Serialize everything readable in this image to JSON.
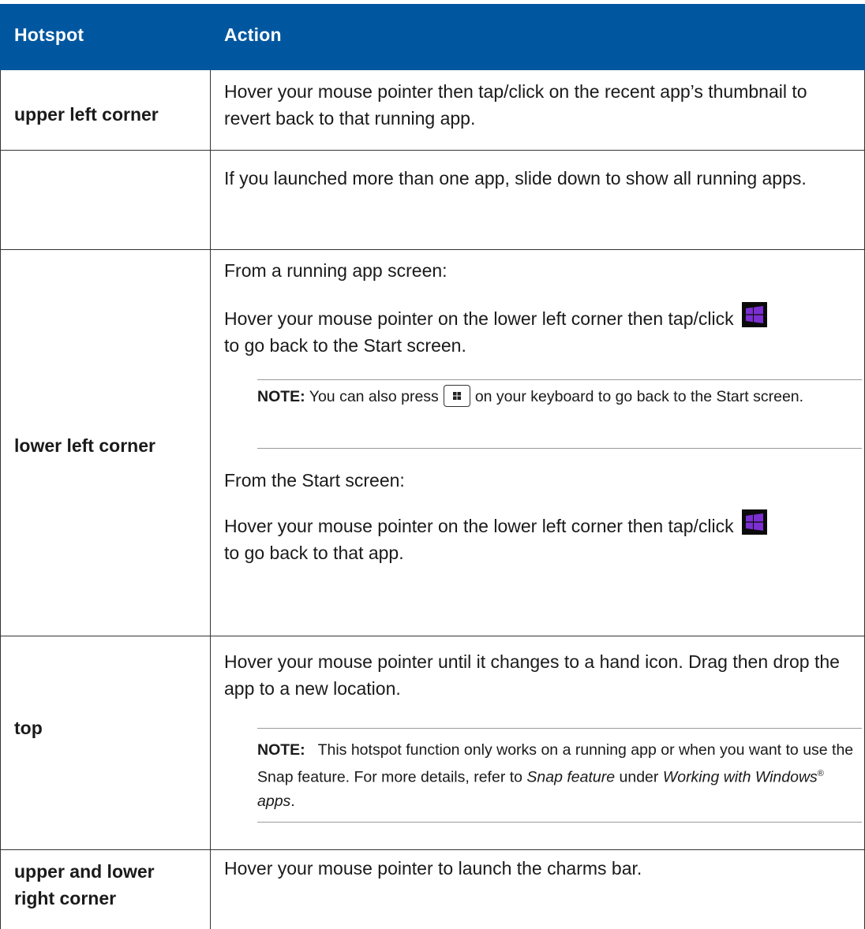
{
  "header": {
    "col1": "Hotspot",
    "col2": "Action"
  },
  "rows": [
    {
      "hotspot": "upper left corner",
      "text": "Hover your mouse pointer then tap/click on the recent app’s thumbnail to revert back to that running app."
    },
    {
      "hotspot": "",
      "text": "If you launched more than one app, slide down to show all running apps."
    },
    {
      "hotspot": "lower left corner",
      "p1": "From a running app screen:",
      "p2": "Hover your mouse pointer on the lower left corner then tap/click",
      "p2_end": "to go back to the Start screen.",
      "note_label": "NOTE:",
      "note_pre": "You can also press",
      "note_post": "on your keyboard to go back to the Start screen.",
      "p3": "From the Start screen:",
      "p4": "Hover your mouse pointer on the lower left corner then tap/click",
      "p4_end": "to go back to that app."
    },
    {
      "hotspot": "top",
      "text": "Hover your mouse pointer until it changes to a hand icon. Drag then drop the app to a new location.",
      "note_label": "NOTE:",
      "note_text": "This hotspot function only works on a running app or when you want to use the Snap feature. For more details, refer to",
      "note_italic1": "Snap feature",
      "note_mid": "under",
      "note_italic2": "Working with Windows",
      "note_sup": "®",
      "note_italic3": "apps",
      "note_end": "."
    },
    {
      "hotspot_line1": "upper and lower",
      "hotspot_line2": "right corner",
      "text": "Hover your mouse pointer to launch the charms bar."
    }
  ],
  "icons": [
    "windows-start-icon",
    "windows-key-icon"
  ],
  "colors": {
    "header_bg": "#0057a0",
    "header_text": "#ffffff",
    "start_tile_bg": "#0b0b0b",
    "logo_purple": "#7b2fd1"
  }
}
